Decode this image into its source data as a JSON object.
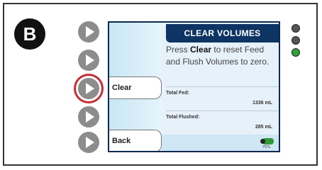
{
  "panel": {
    "badge_letter": "B"
  },
  "screen": {
    "title": "CLEAR VOLUMES",
    "message_prefix": "Press ",
    "message_bold": "Clear",
    "message_suffix": " to reset Feed and Flush Volumes to zero.",
    "clear_label": "Clear",
    "back_label": "Back",
    "total_fed_label": "Total Fed:",
    "total_fed_value": "1336 mL",
    "total_flushed_label": "Total Flushed:",
    "total_flushed_value": "285 mL",
    "battery_text": "75%"
  },
  "leds": [
    "#555555",
    "#555555",
    "#2fa23a"
  ]
}
